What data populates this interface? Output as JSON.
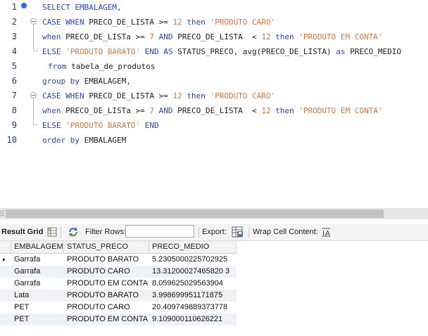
{
  "editor": {
    "lines": [
      {
        "n": "1",
        "segs": [
          {
            "t": "SELECT EMBALAGEM,",
            "c": "kw2"
          }
        ]
      },
      {
        "n": "2",
        "segs": [
          {
            "t": "CASE WHEN",
            "c": "kw"
          },
          {
            "t": " PRECO_DE_LISTA >= ",
            "c": ""
          },
          {
            "t": "12",
            "c": "num"
          },
          {
            "t": " then ",
            "c": "kw"
          },
          {
            "t": "'PRODUTO CARO'",
            "c": "str"
          }
        ]
      },
      {
        "n": "3",
        "segs": [
          {
            "t": "when",
            "c": "kw"
          },
          {
            "t": " PRECO_DE_LISTa >= ",
            "c": ""
          },
          {
            "t": "7",
            "c": "num"
          },
          {
            "t": " AND ",
            "c": "kw"
          },
          {
            "t": "PRECO_DE_LISTA  < ",
            "c": ""
          },
          {
            "t": "12",
            "c": "num"
          },
          {
            "t": " then ",
            "c": "kw"
          },
          {
            "t": "'PRODUTO EM CONTA'",
            "c": "str"
          }
        ]
      },
      {
        "n": "4",
        "segs": [
          {
            "t": "ELSE ",
            "c": "kw"
          },
          {
            "t": "'PRODUTO BARATO'",
            "c": "str"
          },
          {
            "t": " END AS ",
            "c": "kw"
          },
          {
            "t": "STATUS_PRECO, avg(PRECO_DE_LISTA) ",
            "c": ""
          },
          {
            "t": "as",
            "c": "kw"
          },
          {
            "t": " PRECO_MEDIO",
            "c": ""
          }
        ]
      },
      {
        "n": "5",
        "segs": [
          {
            "t": "from",
            "c": "kw"
          },
          {
            "t": " tabela_de_produtos",
            "c": ""
          }
        ]
      },
      {
        "n": "6",
        "segs": [
          {
            "t": "group by",
            "c": "kw"
          },
          {
            "t": " EMBALAGEM,",
            "c": ""
          }
        ]
      },
      {
        "n": "7",
        "segs": [
          {
            "t": "CASE WHEN",
            "c": "kw"
          },
          {
            "t": " PRECO_DE_LISTA >= ",
            "c": ""
          },
          {
            "t": "12",
            "c": "num"
          },
          {
            "t": " then ",
            "c": "kw"
          },
          {
            "t": "'PRODUTO CARO'",
            "c": "str"
          }
        ]
      },
      {
        "n": "8",
        "segs": [
          {
            "t": "when",
            "c": "kw"
          },
          {
            "t": " PRECO_DE_LISTa >= ",
            "c": ""
          },
          {
            "t": "7",
            "c": "num"
          },
          {
            "t": " AND ",
            "c": "kw"
          },
          {
            "t": "PRECO_DE_LISTA  < ",
            "c": ""
          },
          {
            "t": "12",
            "c": "num"
          },
          {
            "t": " then ",
            "c": "kw"
          },
          {
            "t": "'PRODUTO EM CONTA'",
            "c": "str"
          }
        ]
      },
      {
        "n": "9",
        "segs": [
          {
            "t": "ELSE ",
            "c": "kw"
          },
          {
            "t": "'PRODUTO BARATO'",
            "c": "str"
          },
          {
            "t": " END",
            "c": "kw"
          }
        ]
      },
      {
        "n": "10",
        "segs": [
          {
            "t": "order by",
            "c": "kw"
          },
          {
            "t": " EMBALAGEM",
            "c": ""
          }
        ]
      }
    ]
  },
  "toolbar": {
    "result_grid_label": "Result Grid",
    "filter_rows_label": "Filter Rows:",
    "filter_value": "",
    "export_label": "Export:",
    "wrap_label": "Wrap Cell Content:"
  },
  "grid": {
    "columns": [
      "EMBALAGEM",
      "STATUS_PRECO",
      "PRECO_MEDIO"
    ],
    "rows": [
      [
        "Garrafa",
        "PRODUTO BARATO",
        "5.2305000225702925"
      ],
      [
        "Garrafa",
        "PRODUTO CARO",
        "13.31200027465820 3"
      ],
      [
        "Garrafa",
        "PRODUTO EM CONTA",
        "8.059625029563904"
      ],
      [
        "Lata",
        "PRODUTO BARATO",
        "3.998699951171875"
      ],
      [
        "PET",
        "PRODUTO CARO",
        "20.409749889373778"
      ],
      [
        "PET",
        "PRODUTO EM CONTA",
        "9.109000110626221"
      ]
    ]
  },
  "colors": {
    "keyword": "#2446c8",
    "string": "#e0743a",
    "line_number": "#1f3a78",
    "row_alt": "#eef3fa"
  }
}
